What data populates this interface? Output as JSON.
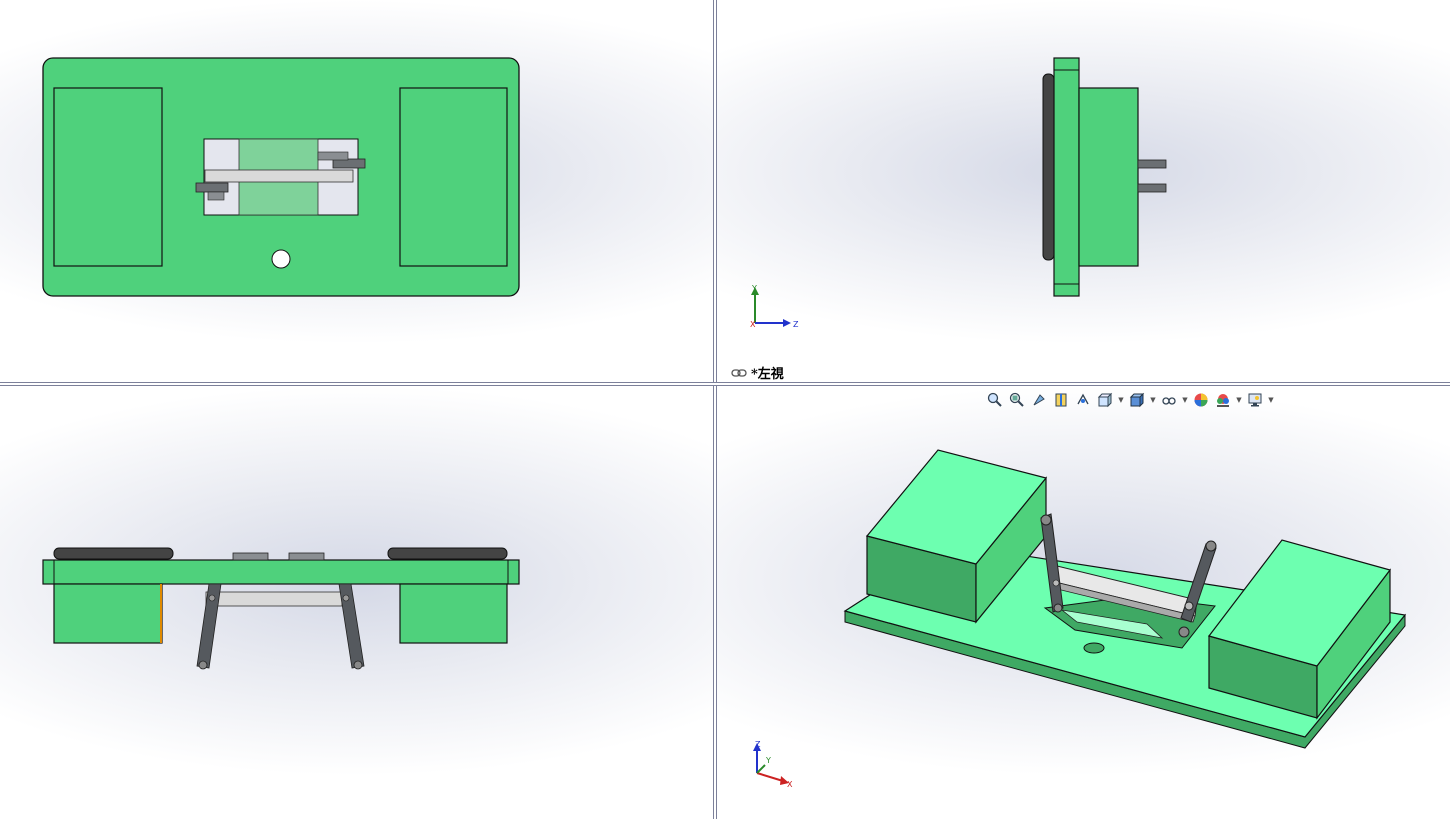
{
  "view_label": "*左視",
  "toolbar": {
    "buttons": [
      {
        "name": "zoom-to-fit-icon"
      },
      {
        "name": "zoom-to-area-icon"
      },
      {
        "name": "previous-view-icon"
      },
      {
        "name": "section-view-icon"
      },
      {
        "name": "dynamic-annotation-icon"
      },
      {
        "name": "view-orientation-icon",
        "dropdown": true
      },
      {
        "name": "display-style-icon",
        "dropdown": true
      },
      {
        "name": "hide-show-items-icon",
        "dropdown": true
      },
      {
        "name": "edit-appearance-icon"
      },
      {
        "name": "apply-scene-icon",
        "dropdown": true
      },
      {
        "name": "view-settings-icon",
        "dropdown": true
      }
    ]
  },
  "triads": {
    "left_view": {
      "vertical": "Y",
      "horizontal": "Z",
      "origin": "X"
    },
    "iso_view": {
      "vertical": "Z",
      "horizontal": "X",
      "depth": "Y"
    }
  },
  "colors": {
    "part_green": "#4fd17c",
    "iso_light_green": "#6dffb0",
    "iso_dark_green": "#3fa964",
    "link_grey": "#55595e",
    "rail_grey": "#d9d9d9"
  }
}
